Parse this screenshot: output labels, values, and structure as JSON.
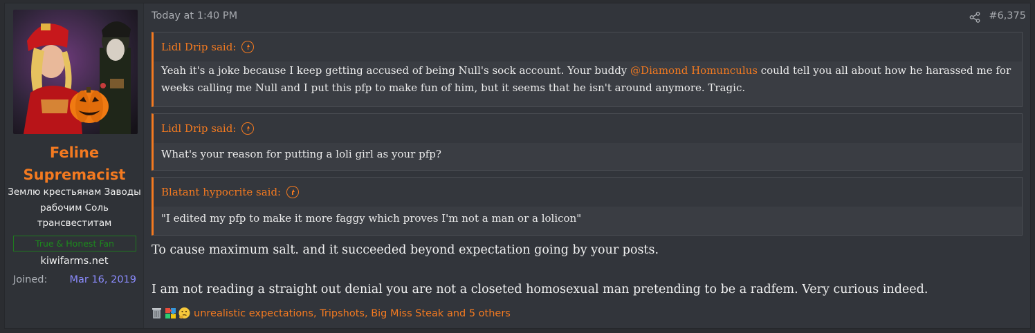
{
  "user": {
    "name": "Feline Supremacist",
    "title": "Землю крестьянам Заводы рабочим Соль трансвеститам",
    "banner": "True & Honest Fan",
    "site": "kiwifarms.net",
    "joined_label": "Joined:",
    "joined_value": "Mar 16, 2019"
  },
  "post": {
    "timestamp": "Today at 1:40 PM",
    "number": "#6,375",
    "quotes": [
      {
        "author": "Lidl Drip said:",
        "text_before": "Yeah it's a joke because I keep getting accused of being Null's sock account. Your buddy ",
        "mention": "@Diamond Homunculus",
        "text_after": " could tell you all about how he harassed me for weeks calling me Null and I put this pfp to make fun of him, but it seems that he isn't around anymore. Tragic."
      },
      {
        "author": "Lidl Drip said:",
        "text": "What's your reason for putting a loli girl as your pfp?"
      },
      {
        "author": "Blatant hypocrite said:",
        "text": "\"I edited my pfp to make it more faggy which proves I'm not a man or a lolicon\""
      }
    ],
    "reply_lines": [
      "To cause maximum salt. and it succeeded beyond expectation going by your posts.",
      "I am not reading a straight out denial you are not a closeted homosexual man pretending to be a radfem. Very curious indeed."
    ],
    "reactions_text": "unrealistic expectations, Tripshots, Big Miss Steak and 5 others",
    "reaction_icons": [
      "trash-can-icon",
      "puzzle-icon",
      "thinking-face-icon"
    ]
  },
  "colors": {
    "accent": "#f47a20",
    "joined_date": "#8c8cff",
    "banner_green": "#1d8a1d"
  }
}
